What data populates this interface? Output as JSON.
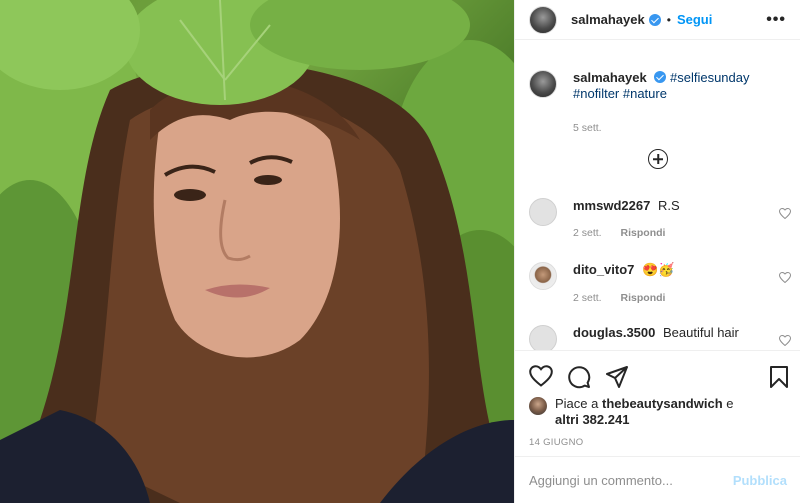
{
  "header": {
    "username": "salmahayek",
    "separator": "•",
    "follow_label": "Segui",
    "more_icon": "more-icon",
    "more_glyph": "•••"
  },
  "caption": {
    "username": "salmahayek",
    "tags_line1": "#selfiesunday",
    "tags_line2": "#nofilter #nature",
    "time": "5 sett."
  },
  "comments": [
    {
      "username": "mmswd2267",
      "text": "R.S",
      "time": "2 sett.",
      "reply": "Rispondi"
    },
    {
      "username": "dito_vito7",
      "text": "😍🥳",
      "time": "2 sett.",
      "reply": "Rispondi"
    },
    {
      "username": "douglas.3500",
      "text": "Beautiful hair"
    }
  ],
  "likes": {
    "prefix": "Piace a",
    "user": "thebeautysandwich",
    "connector": "e",
    "others": "altri 382.241"
  },
  "post_date": "14 GIUGNO",
  "add_comment": {
    "placeholder": "Aggiungi un commento...",
    "publish_label": "Pubblica"
  },
  "colors": {
    "accent": "#0095f6",
    "verified": "#3897f0",
    "hashtag": "#00376b",
    "muted": "#8e8e8e",
    "publish_disabled": "#b2dffc"
  }
}
